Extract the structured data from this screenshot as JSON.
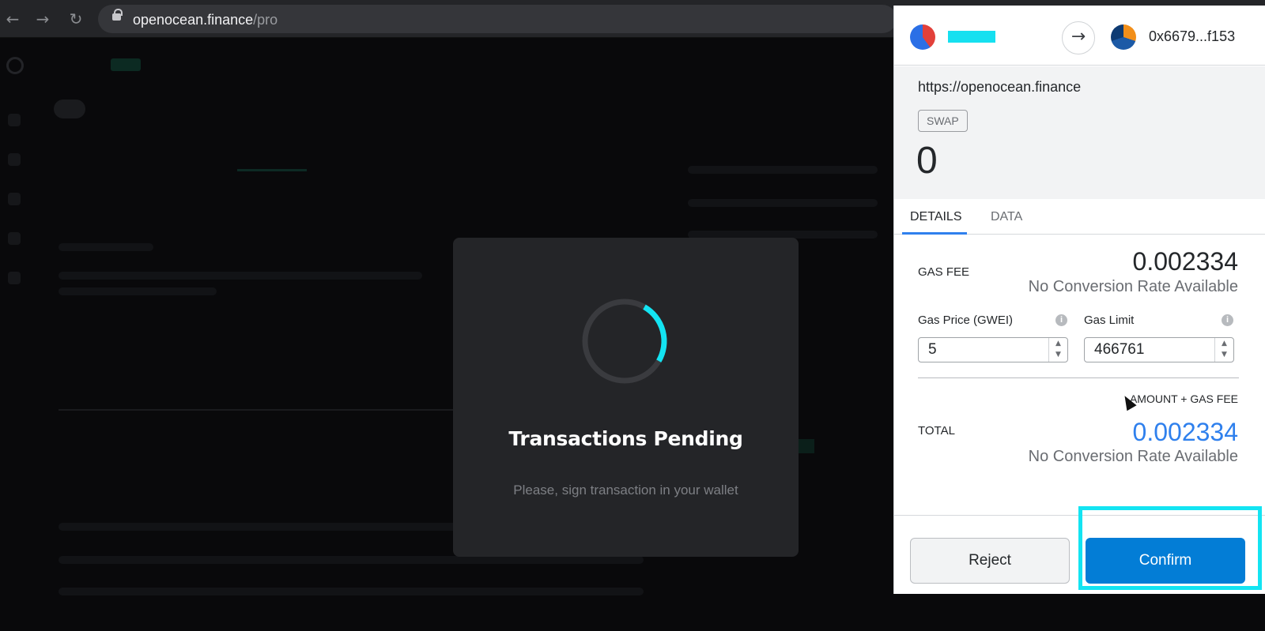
{
  "browser": {
    "nav_back_icon": "←",
    "nav_forward_icon": "→",
    "reload_icon": "↻",
    "url_host": "openocean.finance",
    "url_path": "/pro"
  },
  "modal": {
    "title": "Transactions Pending",
    "subtitle": "Please, sign transaction in your wallet",
    "spinner_progress": 0.25,
    "spinner_color": "#13e4f2"
  },
  "wallet": {
    "destination_address": "0x6679...f153",
    "origin": "https://openocean.finance",
    "method_tag": "SWAP",
    "amount": "0",
    "tabs": [
      {
        "label": "DETAILS",
        "active": true
      },
      {
        "label": "DATA",
        "active": false
      }
    ],
    "gas_fee": {
      "label": "GAS FEE",
      "value": "0.002334",
      "conversion": "No Conversion Rate Available"
    },
    "gas_price": {
      "label": "Gas Price (GWEI)",
      "value": "5"
    },
    "gas_limit": {
      "label": "Gas Limit",
      "value": "466761"
    },
    "total": {
      "caption": "AMOUNT + GAS FEE",
      "label": "TOTAL",
      "value": "0.002334",
      "conversion": "No Conversion Rate Available"
    },
    "reject_label": "Reject",
    "confirm_label": "Confirm",
    "accent_color": "#037dd6"
  }
}
